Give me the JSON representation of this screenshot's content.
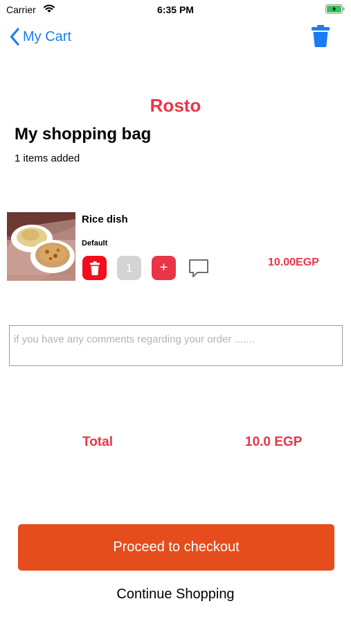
{
  "status_bar": {
    "carrier": "Carrier",
    "time": "6:35 PM"
  },
  "nav": {
    "back_label": "My Cart",
    "back_icon": "chevron-left-icon",
    "action_icon": "trash-icon"
  },
  "header": {
    "restaurant": "Rosto",
    "title": "My shopping bag",
    "items_added": "1 items added"
  },
  "cart": {
    "items": [
      {
        "name": "Rice dish",
        "variant": "Default",
        "quantity": "1",
        "add_label": "+",
        "price": "10.00EGP"
      }
    ]
  },
  "comments": {
    "placeholder": "if you have any comments regarding your order ......."
  },
  "totals": {
    "label": "Total",
    "value": "10.0 EGP"
  },
  "actions": {
    "checkout": "Proceed to checkout",
    "continue": "Continue Shopping"
  },
  "colors": {
    "accent_blue": "#1a7cf5",
    "brand_red": "#ea3546",
    "delete_red": "#f10d1d",
    "checkout_orange": "#e64d1c",
    "qty_gray": "#d4d4d4",
    "battery_green": "#3ac158"
  }
}
